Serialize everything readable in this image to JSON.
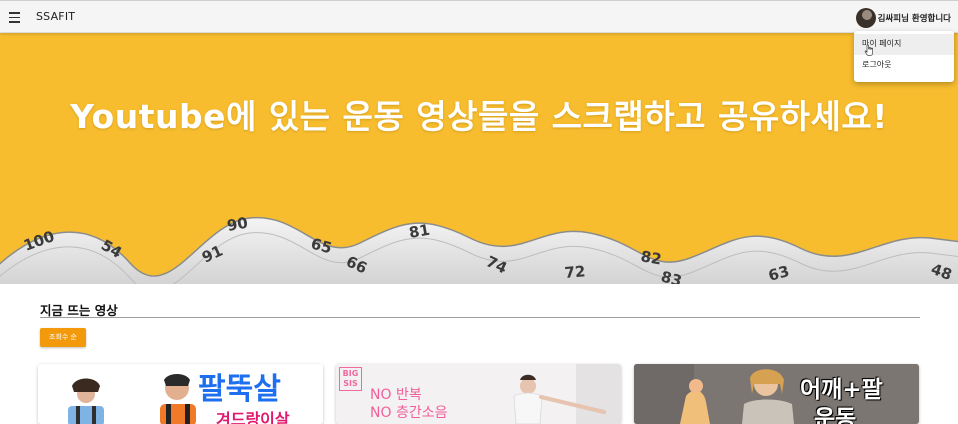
{
  "appbar": {
    "brand": "SSAFIT",
    "welcome": "김싸피님 환영합니다"
  },
  "user_menu": {
    "items": [
      {
        "label": "마이 페이지"
      },
      {
        "label": "로그아웃"
      }
    ]
  },
  "hero": {
    "headline": "Youtube에 있는 운동 영상들을 스크랩하고 공유하세요!",
    "bg_color": "#f7bd2e"
  },
  "section": {
    "title": "지금 뜨는 영상",
    "sort_label": "조회수 순"
  },
  "videos": [
    {
      "thumb_title": "팔뚝살",
      "thumb_sub": "겨드랑이살"
    },
    {
      "thumb_logo_1": "BIG",
      "thumb_logo_2": "SIS",
      "thumb_line_1": "NO 반복",
      "thumb_line_2": "NO 층간소음"
    },
    {
      "thumb_title": "어깨+팔",
      "thumb_sub": "운동"
    }
  ],
  "colors": {
    "accent": "#f29a0b",
    "appbar_bg": "#f5f5f5"
  }
}
